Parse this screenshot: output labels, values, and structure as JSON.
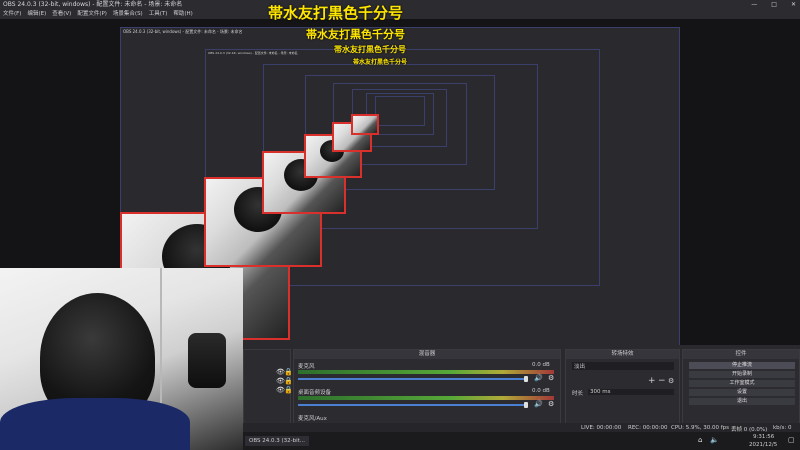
{
  "titlebar": {
    "title": "OBS 24.0.3 (32-bit, windows) - 配置文件: 未命名 - 场景: 未命名",
    "minimize": "—",
    "maximize": "□",
    "close": "✕"
  },
  "menu": [
    "文件(F)",
    "编辑(E)",
    "查看(V)",
    "配置文件(P)",
    "场景集合(S)",
    "工具(T)",
    "帮助(H)"
  ],
  "overlay_text": "帯水友打黒色千分号",
  "nested_title": "OBS 24.0.3 (32-bit, windows) - 配置文件: 未命名 - 场景: 未命名",
  "taskbar_app": "OBS 24.0.3 (32-bit...",
  "mixer": {
    "header": "混音器",
    "track1_name": "麦克风",
    "track1_db": "0.0 dB",
    "track2_name": "桌面音频设备",
    "track2_db": "0.0 dB",
    "track3_name": "麦克风/Aux"
  },
  "transitions": {
    "header": "转场特效",
    "selected": "淡出",
    "duration_label": "时长",
    "duration_value": "300 ms",
    "add": "+",
    "remove": "−",
    "gear": "⚙"
  },
  "controls": {
    "header": "控件",
    "start_stream": "停止推流",
    "start_record": "开始录制",
    "studio_mode": "工作室模式",
    "settings": "设置",
    "exit": "退出"
  },
  "status": {
    "live": "LIVE: 00:00:00",
    "rec": "REC: 00:00:00",
    "cpu": "CPU: 5.9%, 30.00 fps",
    "dropped": "丢帧 0 (0.0%)",
    "kbps": "kb/s: 0"
  },
  "clock": {
    "time": "9:31:56",
    "date": "2021/12/5"
  }
}
